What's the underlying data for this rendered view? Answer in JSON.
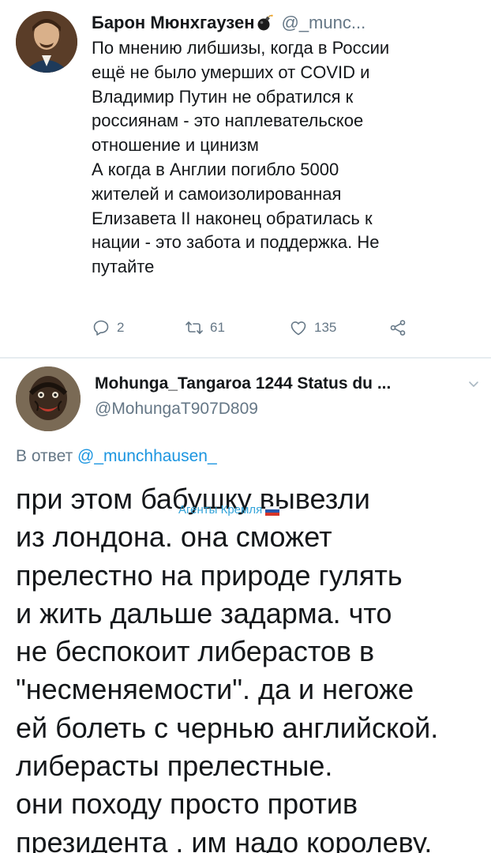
{
  "tweet1": {
    "author_name": "Барон Мюнхгаузен",
    "author_handle": "@_munc...",
    "body_lines": [
      "По мнению либшизы, когда в России",
      "ещё не было умерших от COVID и",
      "Владимир Путин не обратился к",
      "россиянам - это наплевательское",
      "отношение и цинизм",
      "А когда в Англии погибло 5000",
      "жителей и самоизолированная",
      "Елизавета II наконец обратилась к",
      "нации - это забота и поддержка. Не",
      "путайте"
    ],
    "reply_count": "2",
    "retweet_count": "61",
    "like_count": "135"
  },
  "tweet2": {
    "author_name": "Mohunga_Tangaroa 1244 Status du ...",
    "author_handle": "@MohungaT907D809",
    "reply_prefix": "В ответ",
    "reply_to": "@_munchhausen_",
    "body_lines": [
      "при этом бабушку вывезли",
      "из лондона. она сможет",
      "прелестно на природе гулять",
      "и жить дальше задарма. что",
      "не беспокоит либерастов в",
      "\"несменяемости\". да и негоже",
      "ей болеть с чернью английской.",
      "либерасты прелестные.",
      "они походу просто против",
      "президента . им надо королеву."
    ]
  },
  "watermark": "Агенты Кремля",
  "colors": {
    "text": "#14171a",
    "muted": "#657786",
    "link": "#1b95e0",
    "watermark": "#2aa0d8",
    "divider": "#e6ecf0"
  },
  "icons": [
    "bomb-icon",
    "reply-icon",
    "retweet-icon",
    "like-icon",
    "share-icon",
    "chevron-down-icon",
    "flag-icon"
  ]
}
